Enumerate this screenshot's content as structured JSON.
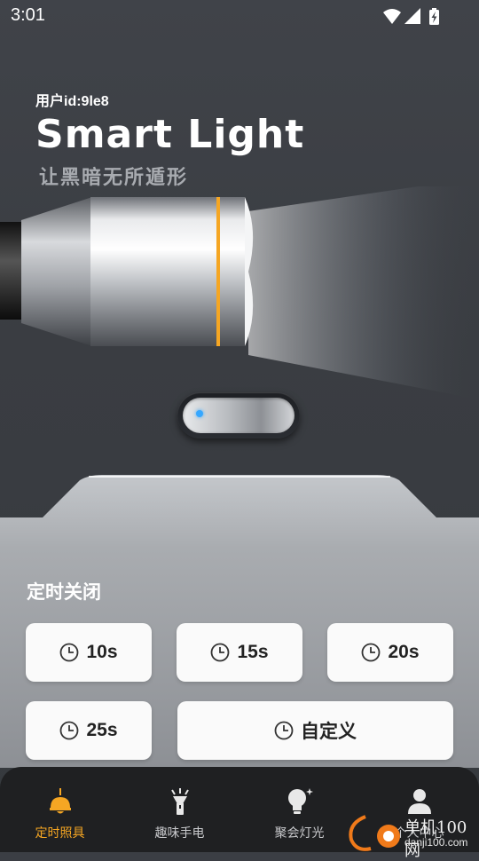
{
  "status_bar": {
    "time": "3:01"
  },
  "header": {
    "user_id": "用户id:9le8",
    "title": "Smart Light",
    "subtitle": "让黑暗无所遁形"
  },
  "timer": {
    "title": "定时关闭",
    "options": [
      "10s",
      "15s",
      "20s",
      "25s",
      "自定义"
    ]
  },
  "nav": {
    "items": [
      {
        "label": "定时照具",
        "icon": "lamp-icon",
        "active": true
      },
      {
        "label": "趣味手电",
        "icon": "flashlight-icon",
        "active": false
      },
      {
        "label": "聚会灯光",
        "icon": "bulb-icon",
        "active": false
      },
      {
        "label": "个人中心",
        "icon": "person-icon",
        "active": false
      }
    ]
  },
  "watermark": {
    "title": "单机100网",
    "url": "danji100.com"
  },
  "colors": {
    "accent": "#f5a623",
    "toggle_dot": "#35a7ff",
    "nav_bg": "#1f2022"
  }
}
